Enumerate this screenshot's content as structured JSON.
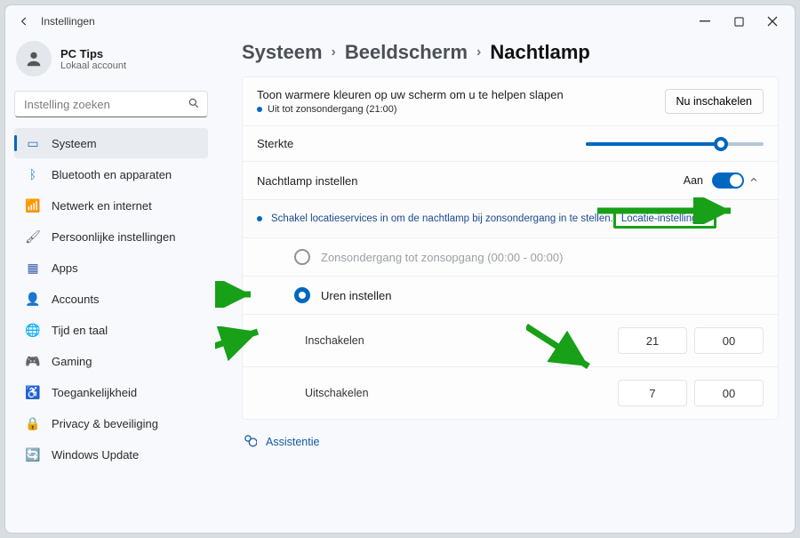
{
  "titlebar": {
    "title": "Instellingen"
  },
  "account": {
    "name": "PC Tips",
    "subtitle": "Lokaal account"
  },
  "search": {
    "placeholder": "Instelling zoeken"
  },
  "sidebar_items": [
    {
      "label": "Systeem",
      "color": "#2b6fb3"
    },
    {
      "label": "Bluetooth en apparaten",
      "color": "#1e88d6"
    },
    {
      "label": "Netwerk en internet",
      "color": "#1aa0c8"
    },
    {
      "label": "Persoonlijke instellingen",
      "color": "#5a5f66"
    },
    {
      "label": "Apps",
      "color": "#3b5ea9"
    },
    {
      "label": "Accounts",
      "color": "#d28a1f"
    },
    {
      "label": "Tijd en taal",
      "color": "#1fa0c3"
    },
    {
      "label": "Gaming",
      "color": "#5a5f66"
    },
    {
      "label": "Toegankelijkheid",
      "color": "#3a75c4"
    },
    {
      "label": "Privacy & beveiliging",
      "color": "#5a5f66"
    },
    {
      "label": "Windows Update",
      "color": "#1e88d6"
    }
  ],
  "breadcrumb": {
    "a": "Systeem",
    "b": "Beeldscherm",
    "c": "Nachtlamp"
  },
  "card": {
    "desc": "Toon warmere kleuren op uw scherm om u te helpen slapen",
    "status": "Uit tot zonsondergang (21:00)",
    "turn_on_btn": "Nu inschakelen",
    "strength_label": "Sterkte",
    "schedule_label": "Nachtlamp instellen",
    "schedule_state": "Aan",
    "info_text": "Schakel locatieservices in om de nachtlamp bij zonsondergang in te stellen.",
    "location_btn": "Locatie-instellingen",
    "radio_sunset": "Zonsondergang tot zonsopgang (00:00 - 00:00)",
    "radio_hours": "Uren instellen",
    "time_on_label": "Inschakelen",
    "time_off_label": "Uitschakelen",
    "time_on_h": "21",
    "time_on_m": "00",
    "time_off_h": "7",
    "time_off_m": "00"
  },
  "assist": "Assistentie"
}
